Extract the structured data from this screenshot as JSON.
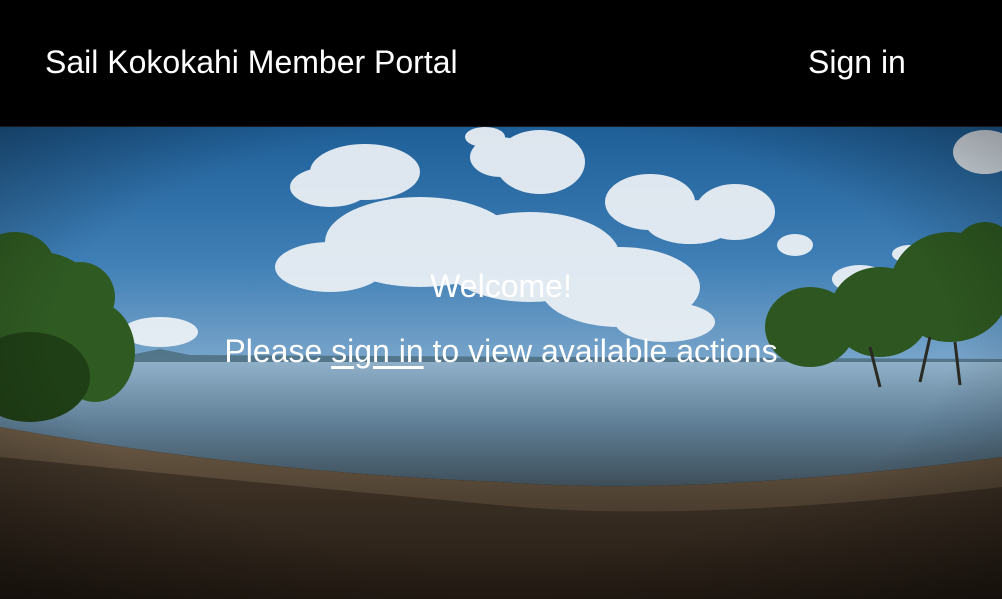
{
  "navbar": {
    "brand": "Sail Kokokahi Member Portal",
    "sign_in": "Sign in"
  },
  "hero": {
    "welcome": "Welcome!",
    "prompt_before": "Please ",
    "prompt_link": "sign in",
    "prompt_after": " to view available actions"
  },
  "colors": {
    "navbar_bg": "#000000",
    "text": "#ffffff"
  }
}
